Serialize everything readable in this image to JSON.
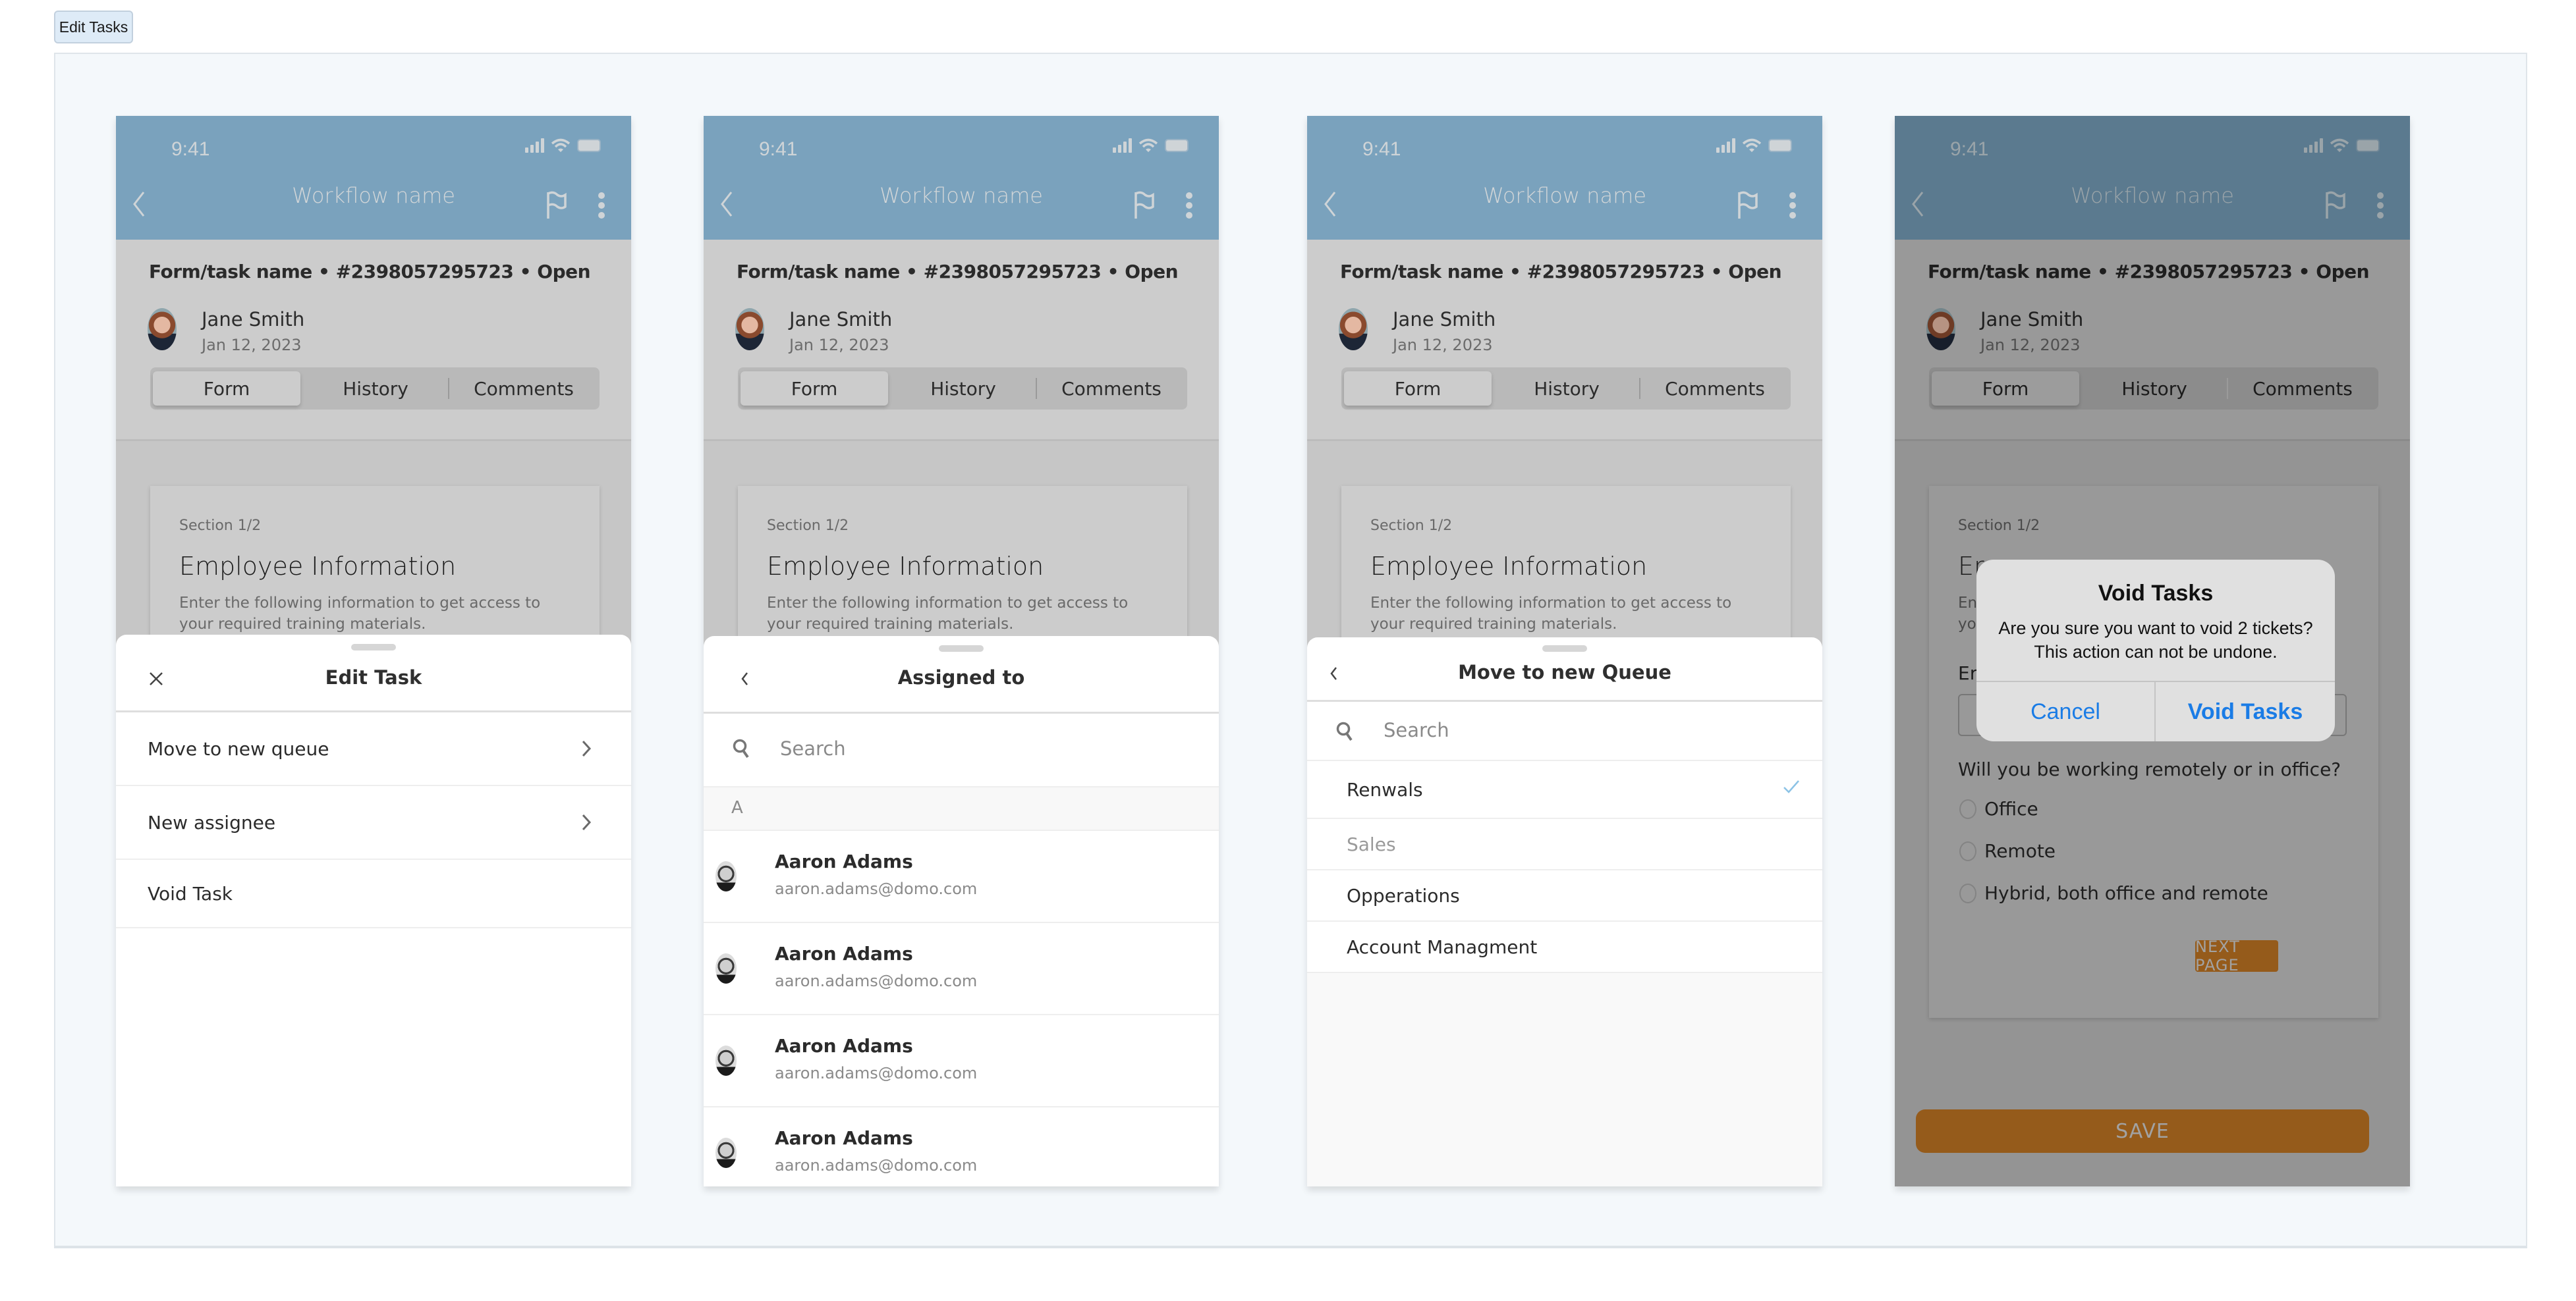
{
  "frame_tag": "Edit Tasks",
  "status_bar": {
    "time": "9:41"
  },
  "nav": {
    "title": "Workflow name",
    "icons": [
      "chevron-left-icon",
      "flag-icon",
      "more-vertical-icon"
    ]
  },
  "task": {
    "header": "Form/task name  •  #2398057295723  • Open",
    "assignee_name": "Jane Smith",
    "date": "Jan 12, 2023"
  },
  "tabs": [
    {
      "label": "Form",
      "active": true
    },
    {
      "label": "History",
      "active": false
    },
    {
      "label": "Comments",
      "active": false
    }
  ],
  "form": {
    "section_label": "Section 1/2",
    "section_title": "Employee Information",
    "section_desc": "Enter the following information to get access to your required training materials.",
    "field_label_partial": "Er",
    "title_partial": "Er",
    "desc_partial_1": "En",
    "desc_partial_2": "yo",
    "question": "Will you be working remotely or in office?",
    "options": [
      "Office",
      "Remote",
      "Hybrid, both office and remote"
    ],
    "next_label": "NEXT PAGE",
    "save_label": "SAVE"
  },
  "edit_task_sheet": {
    "title": "Edit Task",
    "close_icon": "close-icon",
    "items": [
      {
        "label": "Move to new queue",
        "has_chevron": true
      },
      {
        "label": "New assignee",
        "has_chevron": true
      },
      {
        "label": "Void Task",
        "has_chevron": false
      }
    ]
  },
  "assigned_sheet": {
    "title": "Assigned to",
    "search_placeholder": "Search",
    "section_letter": "A",
    "people": [
      {
        "name": "Aaron Adams",
        "email": "aaron.adams@domo.com"
      },
      {
        "name": "Aaron Adams",
        "email": "aaron.adams@domo.com"
      },
      {
        "name": "Aaron Adams",
        "email": "aaron.adams@domo.com"
      },
      {
        "name": "Aaron Adams",
        "email": "aaron.adams@domo.com"
      }
    ]
  },
  "queue_sheet": {
    "title": "Move to new Queue",
    "search_placeholder": "Search",
    "queues": [
      {
        "label": "Renwals",
        "selected": true,
        "disabled": false
      },
      {
        "label": "Sales",
        "selected": false,
        "disabled": true
      },
      {
        "label": "Opperations",
        "selected": false,
        "disabled": false
      },
      {
        "label": "Account Managment",
        "selected": false,
        "disabled": false
      }
    ]
  },
  "void_alert": {
    "title": "Void Tasks",
    "message": "Are you sure you want to void 2 tickets? This action can not be undone.",
    "cancel_label": "Cancel",
    "confirm_label": "Void Tasks"
  },
  "colors": {
    "header_blue": "#7aa2bd",
    "accent_orange": "#955b1b",
    "ios_blue": "#1a7ce6",
    "check_blue": "#8cc3e6"
  }
}
